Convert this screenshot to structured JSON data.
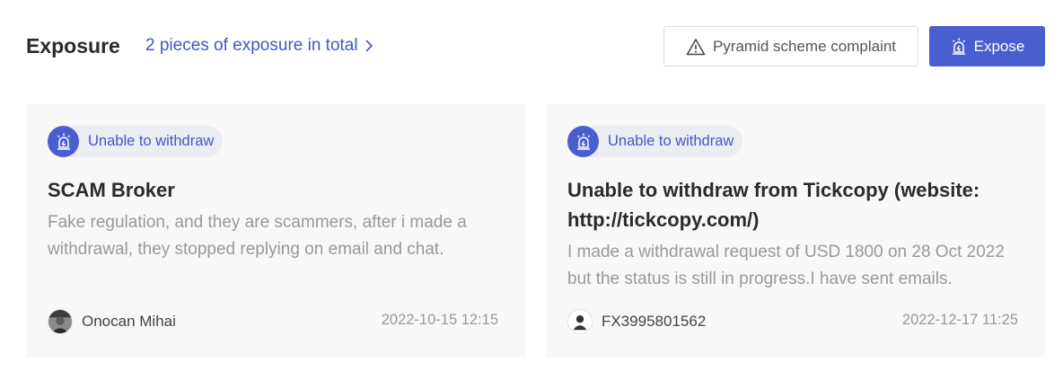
{
  "header": {
    "title": "Exposure",
    "total_link": "2 pieces of exposure in total",
    "complaint_button": "Pyramid scheme complaint",
    "expose_button": "Expose"
  },
  "colors": {
    "accent": "#4a5fcf",
    "link": "#4257c7",
    "card_bg": "#f8f8f8",
    "muted_text": "#999999"
  },
  "cards": [
    {
      "tag": "Unable to withdraw",
      "tag_icon": "siren-alarm-icon",
      "title": "SCAM Broker",
      "description": "Fake regulation, and they are scammers, after i made a withdrawal, they stopped replying on email and chat.",
      "author": "Onocan Mihai",
      "avatar_icon": "user-photo-avatar",
      "date": "2022-10-15 12:15"
    },
    {
      "tag": "Unable to withdraw",
      "tag_icon": "siren-alarm-icon",
      "title": "Unable to withdraw from Tickcopy (website: http://tickcopy.com/)",
      "description": "I made a withdrawal request of USD 1800 on 28 Oct 2022 but the status is still in progress.I have sent emails.",
      "author": "FX3995801562",
      "avatar_icon": "default-user-avatar",
      "date": "2022-12-17 11:25"
    }
  ]
}
